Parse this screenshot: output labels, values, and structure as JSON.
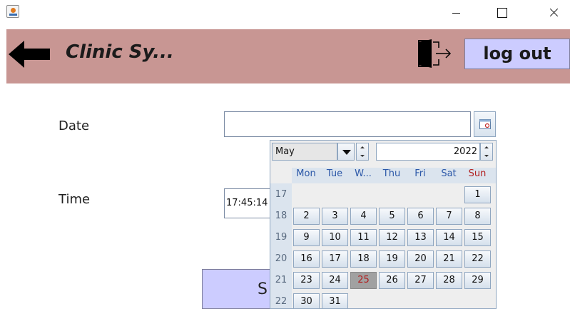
{
  "header": {
    "title": "Clinic Sy...",
    "logout_label": "log out"
  },
  "form": {
    "date_label": "Date",
    "date_value": "",
    "time_label": "Time",
    "time_value": "17:45:14",
    "submit_label": "S"
  },
  "calendar": {
    "month": "May",
    "year": "2022",
    "day_headers": [
      "Mon",
      "Tue",
      "W...",
      "Thu",
      "Fri",
      "Sat",
      "Sun"
    ],
    "weeks": [
      {
        "week": "17",
        "days": [
          "",
          "",
          "",
          "",
          "",
          "",
          "1"
        ]
      },
      {
        "week": "18",
        "days": [
          "2",
          "3",
          "4",
          "5",
          "6",
          "7",
          "8"
        ]
      },
      {
        "week": "19",
        "days": [
          "9",
          "10",
          "11",
          "12",
          "13",
          "14",
          "15"
        ]
      },
      {
        "week": "20",
        "days": [
          "16",
          "17",
          "18",
          "19",
          "20",
          "21",
          "22"
        ]
      },
      {
        "week": "21",
        "days": [
          "23",
          "24",
          "25",
          "26",
          "27",
          "28",
          "29"
        ]
      },
      {
        "week": "22",
        "days": [
          "30",
          "31",
          "",
          "",
          "",
          "",
          ""
        ]
      }
    ],
    "selected_day": "25"
  },
  "colors": {
    "header_bg": "#c89693",
    "button_bg": "#ccccff",
    "weekday_header": "#2c58a8",
    "sunday_header": "#b21f1f",
    "selected_day_bg": "#a1a1a1",
    "selected_day_text": "#b21f1f"
  },
  "icons": {
    "app": "java-app-icon",
    "back": "back-arrow-icon",
    "exit": "exit-door-icon",
    "calendar": "calendar-icon"
  }
}
